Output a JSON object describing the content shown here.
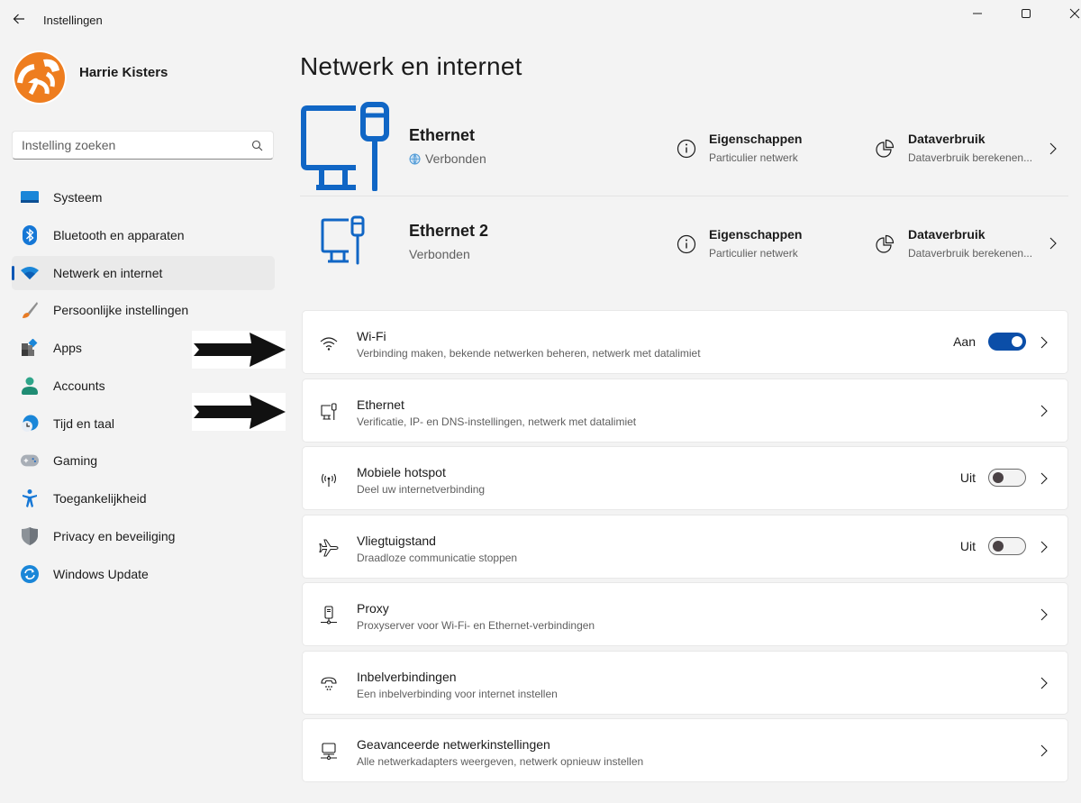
{
  "window": {
    "app_title": "Instellingen",
    "controls": [
      "minimize",
      "maximize",
      "close"
    ]
  },
  "user": {
    "name": "Harrie Kisters"
  },
  "search": {
    "placeholder": "Instelling zoeken",
    "value": ""
  },
  "sidebar": {
    "items": [
      {
        "label": "Systeem",
        "icon": "monitor-icon",
        "active": false
      },
      {
        "label": "Bluetooth en apparaten",
        "icon": "bluetooth-icon",
        "active": false
      },
      {
        "label": "Netwerk en internet",
        "icon": "wifi-icon",
        "active": true
      },
      {
        "label": "Persoonlijke instellingen",
        "icon": "paintbrush-icon",
        "active": false
      },
      {
        "label": "Apps",
        "icon": "apps-icon",
        "active": false
      },
      {
        "label": "Accounts",
        "icon": "person-icon",
        "active": false
      },
      {
        "label": "Tijd en taal",
        "icon": "clock-globe-icon",
        "active": false
      },
      {
        "label": "Gaming",
        "icon": "gamepad-icon",
        "active": false
      },
      {
        "label": "Toegankelijkheid",
        "icon": "accessibility-icon",
        "active": false
      },
      {
        "label": "Privacy en beveiliging",
        "icon": "shield-icon",
        "active": false
      },
      {
        "label": "Windows Update",
        "icon": "update-icon",
        "active": false
      }
    ]
  },
  "main": {
    "title": "Netwerk en internet",
    "connections": [
      {
        "name": "Ethernet",
        "status": "Verbonden",
        "status_icon": "globe-icon",
        "properties_title": "Eigenschappen",
        "properties_sub": "Particulier netwerk",
        "usage_title": "Dataverbruik",
        "usage_sub": "Dataverbruik berekenen..."
      },
      {
        "name": "Ethernet 2",
        "status": "Verbonden",
        "properties_title": "Eigenschappen",
        "properties_sub": "Particulier netwerk",
        "usage_title": "Dataverbruik",
        "usage_sub": "Dataverbruik berekenen..."
      }
    ],
    "cards": [
      {
        "title": "Wi-Fi",
        "sub": "Verbinding maken, bekende netwerken beheren, netwerk met datalimiet",
        "icon": "wifi-icon",
        "toggle": "on",
        "toggle_label": "Aan"
      },
      {
        "title": "Ethernet",
        "sub": "Verificatie, IP- en DNS-instellingen, netwerk met datalimiet",
        "icon": "ethernet-icon"
      },
      {
        "title": "Mobiele hotspot",
        "sub": "Deel uw internetverbinding",
        "icon": "hotspot-icon",
        "toggle": "off",
        "toggle_label": "Uit"
      },
      {
        "title": "Vliegtuigstand",
        "sub": "Draadloze communicatie stoppen",
        "icon": "airplane-icon",
        "toggle": "off",
        "toggle_label": "Uit"
      },
      {
        "title": "Proxy",
        "sub": "Proxyserver voor Wi-Fi- en Ethernet-verbindingen",
        "icon": "proxy-icon"
      },
      {
        "title": "Inbelverbindingen",
        "sub": "Een inbelverbinding voor internet instellen",
        "icon": "dialup-icon"
      },
      {
        "title": "Geavanceerde netwerkinstellingen",
        "sub": "Alle netwerkadapters weergeven, netwerk opnieuw instellen",
        "icon": "network-adapter-icon"
      }
    ]
  },
  "colors": {
    "accent": "#0b57b5",
    "toggle_on": "#0b4ea8",
    "background": "#f3f3f3",
    "card": "#ffffff"
  }
}
